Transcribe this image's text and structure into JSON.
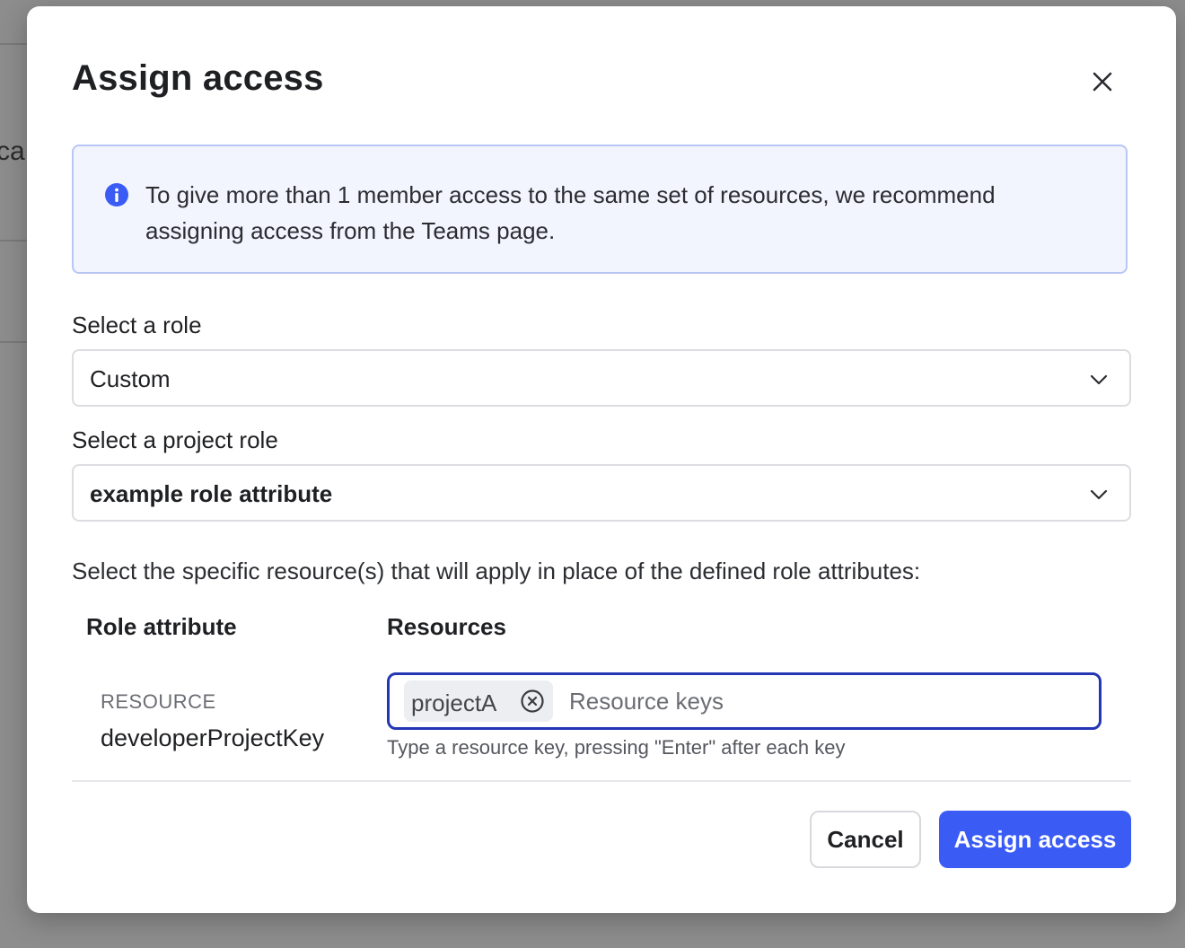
{
  "background": {
    "fragment_text": "ca"
  },
  "modal": {
    "title": "Assign access",
    "close_icon": "close-icon"
  },
  "info_banner": {
    "icon": "info-icon",
    "text": "To give more than 1 member access to the same set of resources, we recommend assigning access from the Teams page."
  },
  "role_select": {
    "label": "Select a role",
    "value": "Custom"
  },
  "project_role_select": {
    "label": "Select a project role",
    "value": "example role attribute"
  },
  "resources": {
    "instruction": "Select the specific resource(s) that will apply in place of the defined role attributes:",
    "columns": {
      "role_attribute": "Role attribute",
      "resources": "Resources"
    },
    "rows": [
      {
        "kind": "RESOURCE",
        "name": "developerProjectKey",
        "chips": [
          "projectA"
        ],
        "input_value": "",
        "placeholder": "Resource keys",
        "helper": "Type a resource key, pressing \"Enter\" after each key"
      }
    ]
  },
  "footer": {
    "cancel_label": "Cancel",
    "submit_label": "Assign access"
  },
  "colors": {
    "primary": "#3a5cf5",
    "focus_border": "#2536b5",
    "info_background": "#f2f5fe",
    "info_border": "#b8c6f6",
    "overlay": "#8d8d8d"
  }
}
